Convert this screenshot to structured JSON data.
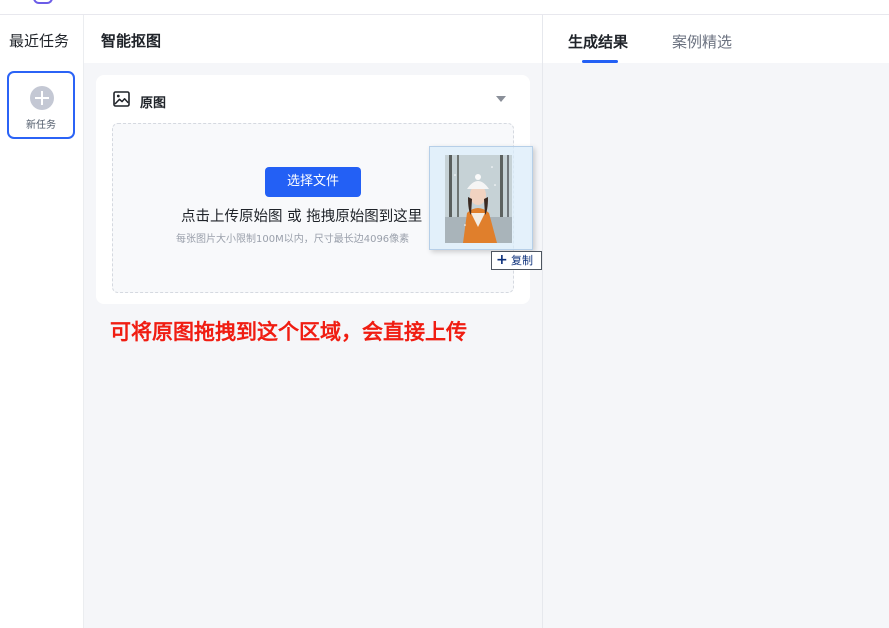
{
  "sidebar": {
    "title": "最近任务",
    "new_task_label": "新任务"
  },
  "editor": {
    "title": "智能抠图",
    "card": {
      "title": "原图",
      "upload_button": "选择文件",
      "drop_main_text": "点击上传原始图 或 拖拽原始图到这里",
      "drop_sub_text": "每张图片大小限制100M以内，尺寸最长边4096像素"
    },
    "drag_copy_label": "复制",
    "annotation": "可将原图拖拽到这个区域，会直接上传"
  },
  "results": {
    "tabs": [
      {
        "label": "生成结果",
        "active": true
      },
      {
        "label": "案例精选",
        "active": false
      }
    ]
  },
  "colors": {
    "accent": "#2360f5",
    "annotation": "#f01d12"
  },
  "icons": {
    "card_icon": "image-icon",
    "caret": "caret-down-icon",
    "new_task": "plus-circle-icon"
  }
}
